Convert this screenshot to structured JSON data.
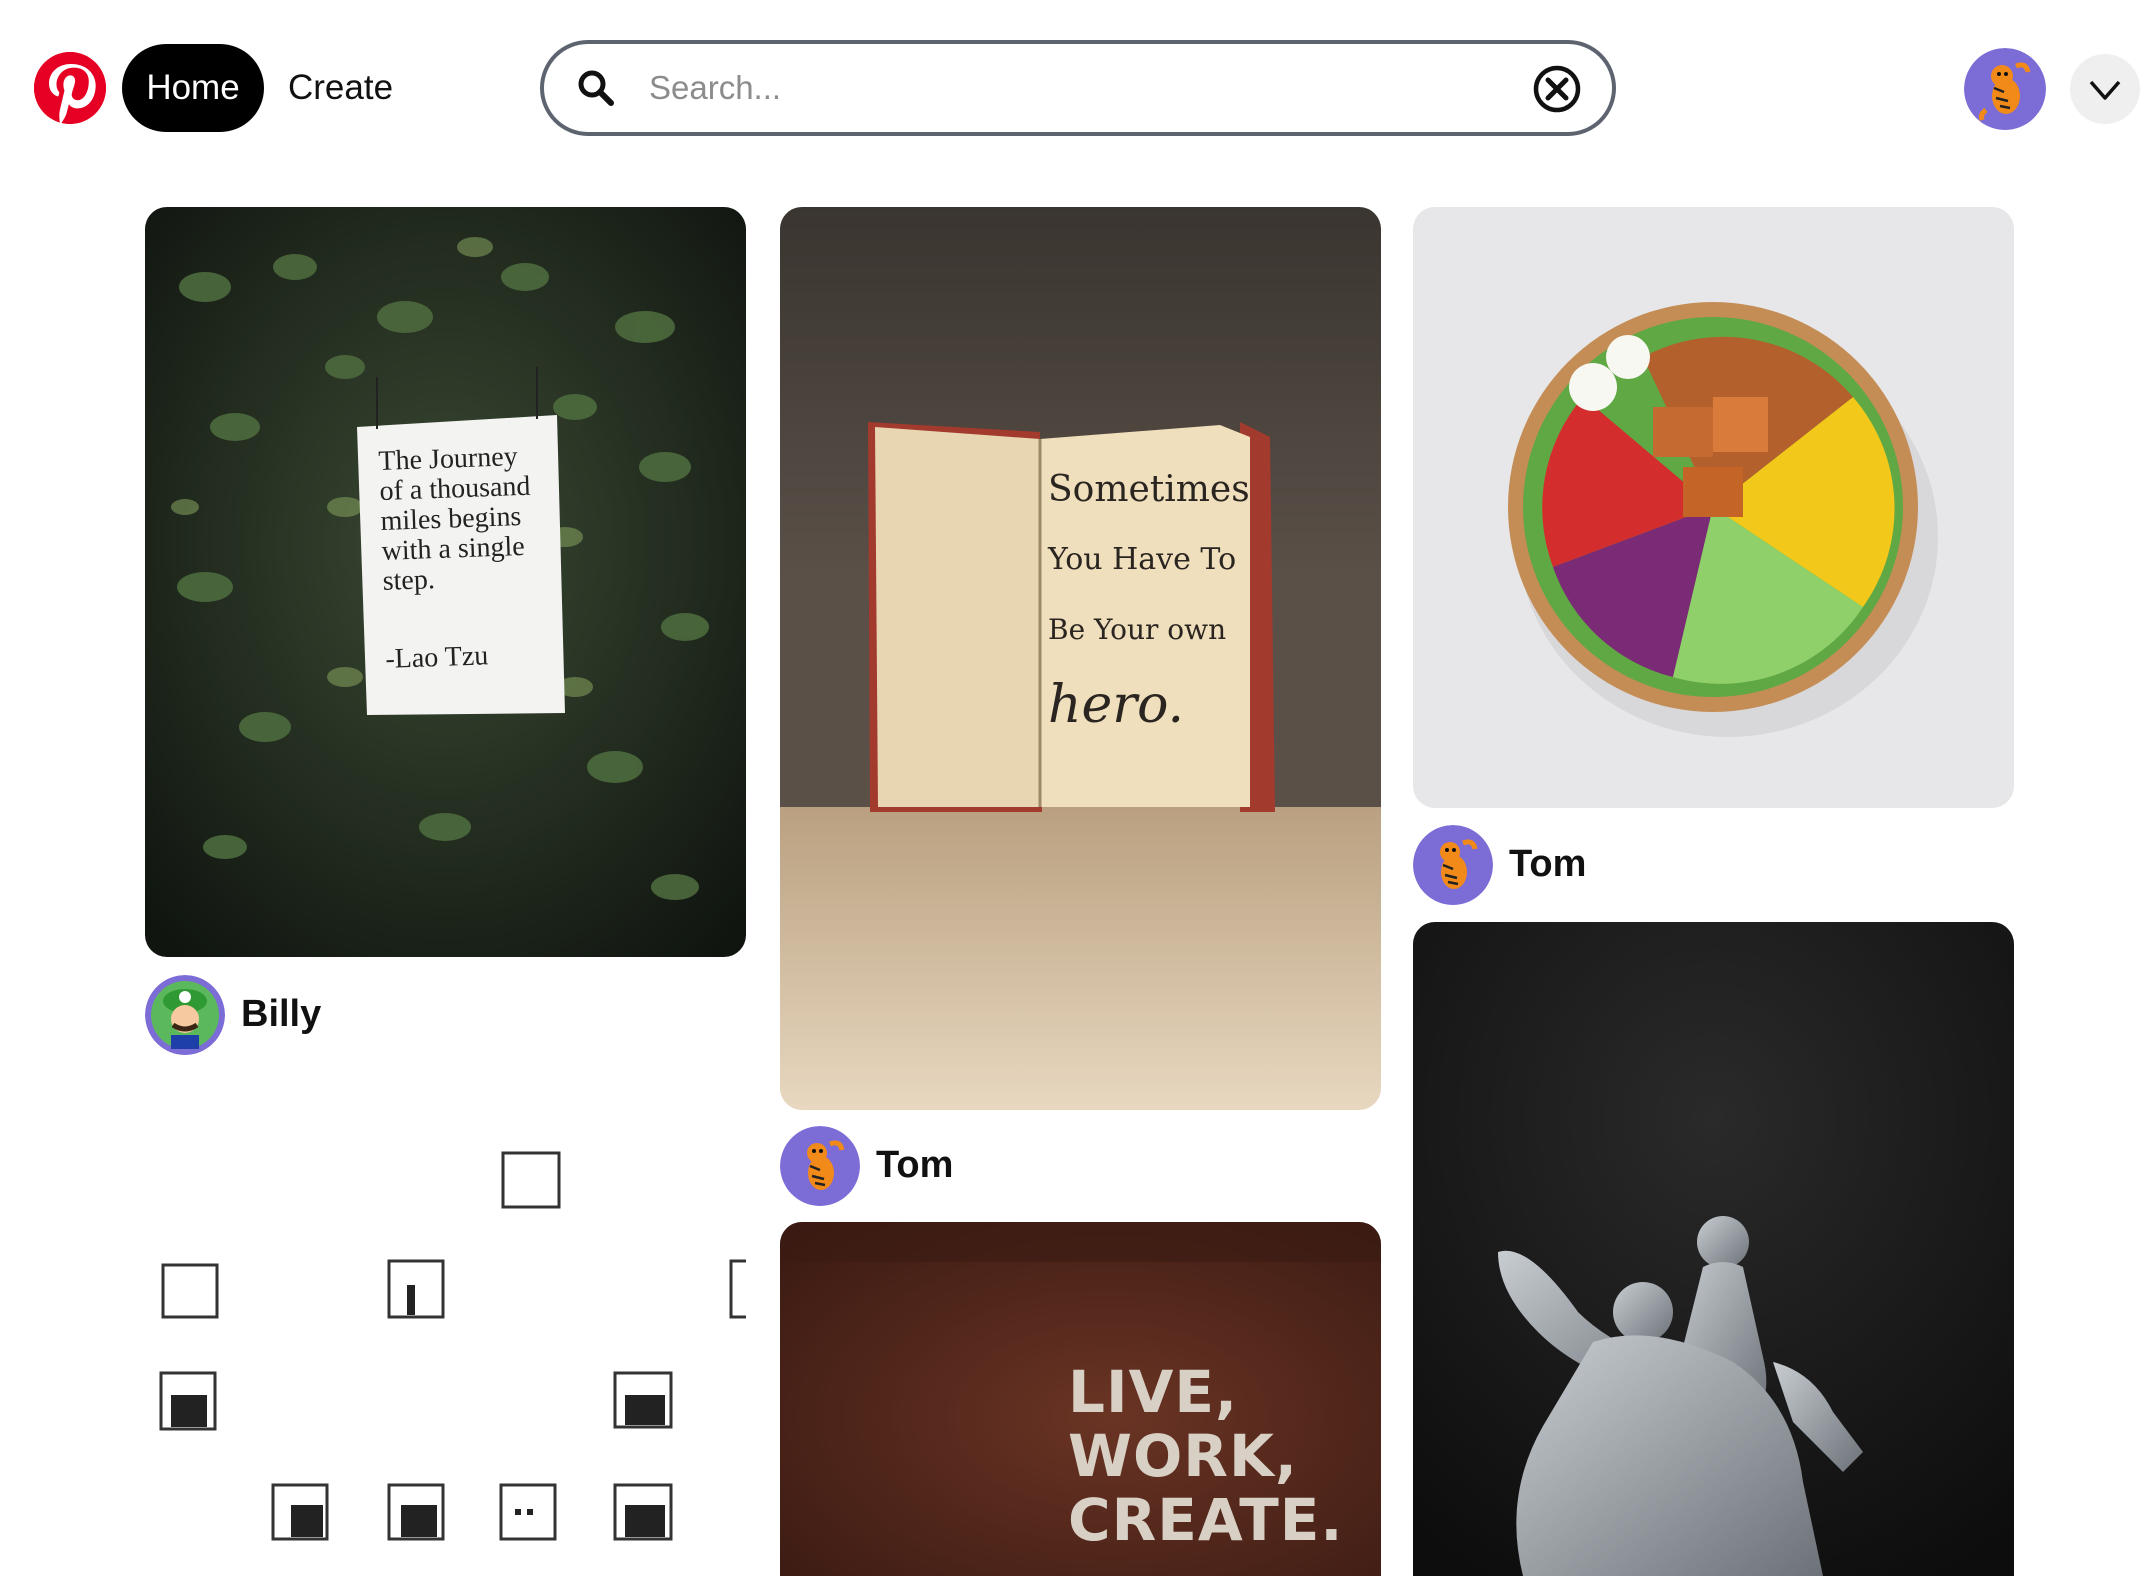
{
  "header": {
    "logo_icon": "pinterest-logo-icon",
    "home_label": "Home",
    "create_label": "Create",
    "search": {
      "placeholder": "Search...",
      "value": "",
      "search_icon": "search-icon",
      "clear_icon": "clear-circle-icon"
    },
    "profile_icon": "tiger-avatar-icon",
    "menu_icon": "chevron-down-icon"
  },
  "colors": {
    "brand": "#e60023",
    "avatar_purple": "#7c6cd6",
    "text": "#111111"
  },
  "pins": [
    {
      "image_text": [
        "The Journey",
        "of a thousand",
        "miles begins",
        "with a single",
        "step.",
        "-Lao Tzu"
      ],
      "author": "Billy",
      "avatar_icon": "luigi-avatar-icon"
    },
    {
      "image_text": [
        "Sometimes",
        "You Have To",
        "Be Your own",
        "hero."
      ],
      "author": "Tom",
      "avatar_icon": "tiger-avatar-icon"
    },
    {
      "image_text": [],
      "author": "Tom",
      "avatar_icon": "tiger-avatar-icon"
    },
    {
      "image_text": [],
      "author": "",
      "avatar_icon": ""
    },
    {
      "image_text": [
        "LIVE,",
        "WORK,",
        "CREATE."
      ],
      "author": "",
      "avatar_icon": ""
    },
    {
      "image_text": [],
      "author": "",
      "avatar_icon": ""
    }
  ]
}
